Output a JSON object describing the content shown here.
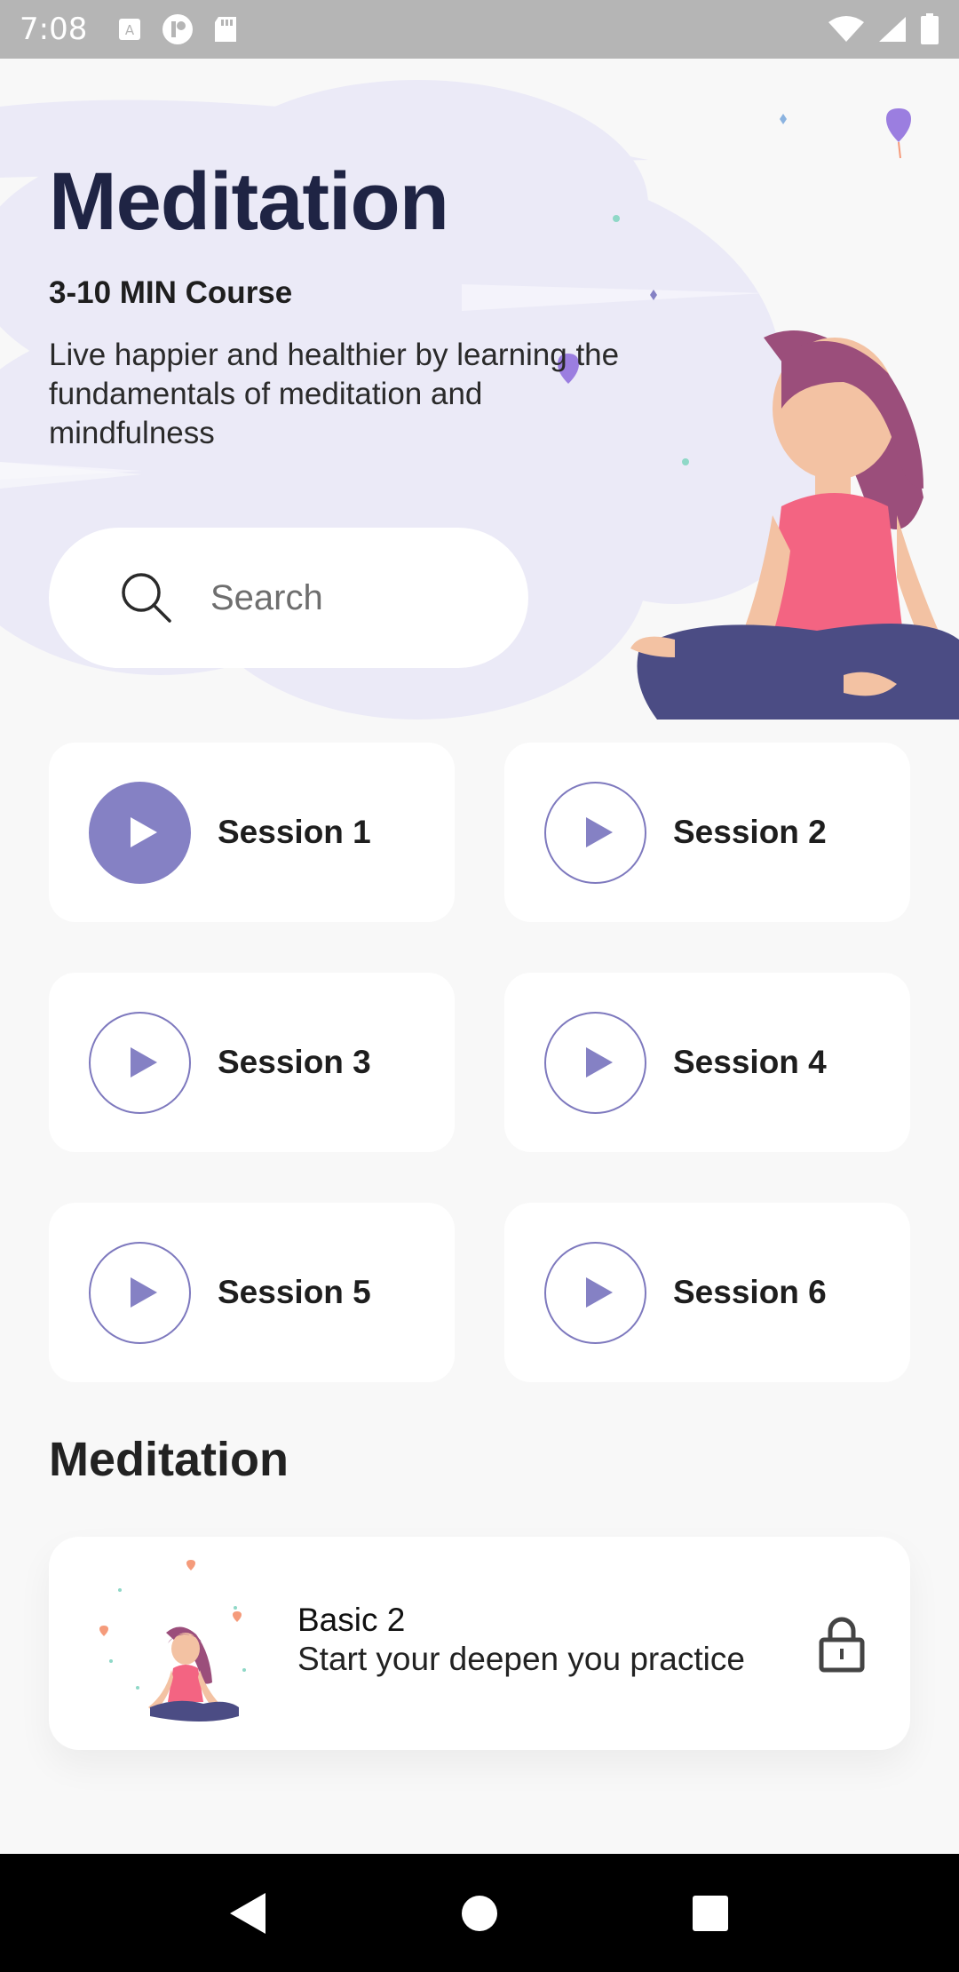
{
  "status_bar": {
    "time": "7:08"
  },
  "header": {
    "title": "Meditation",
    "subtitle": "3-10 MIN Course",
    "description": "Live happier and healthier by learning the fundamentals of meditation and mindfulness"
  },
  "search": {
    "placeholder": "Search"
  },
  "sessions": [
    {
      "label": "Session 1",
      "active": true
    },
    {
      "label": "Session 2",
      "active": false
    },
    {
      "label": "Session 3",
      "active": false
    },
    {
      "label": "Session 4",
      "active": false
    },
    {
      "label": "Session 5",
      "active": false
    },
    {
      "label": "Session 6",
      "active": false
    }
  ],
  "section": {
    "heading": "Meditation"
  },
  "course": {
    "title": "Basic 2",
    "subtitle": "Start your deepen you practice",
    "locked": true
  },
  "colors": {
    "accent": "#8581c4",
    "title": "#1f2444",
    "cloud": "#ebeaf7",
    "figure_top": "#f36482",
    "figure_hair": "#9b4e7b",
    "figure_pants": "#4b4c84"
  }
}
